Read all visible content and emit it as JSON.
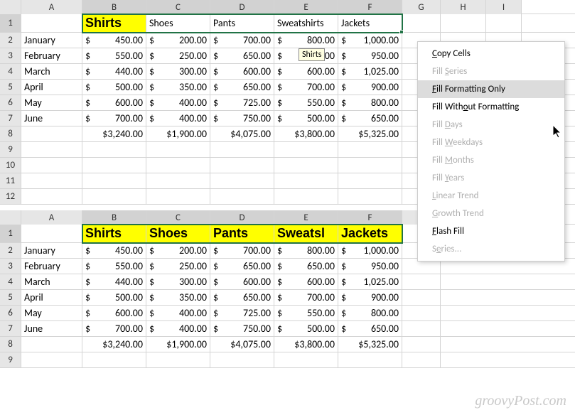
{
  "columns": [
    "A",
    "B",
    "C",
    "D",
    "E",
    "F",
    "G",
    "H",
    "I"
  ],
  "top": {
    "rows": [
      "1",
      "2",
      "3",
      "4",
      "5",
      "6",
      "7",
      "8",
      "9",
      "10",
      "11",
      "12"
    ],
    "headers": [
      "Shirts",
      "Shoes",
      "Pants",
      "Sweatshirts",
      "Jackets"
    ],
    "months": [
      "January",
      "February",
      "March",
      "April",
      "May",
      "June"
    ],
    "data": [
      [
        "$ 450.00",
        "$ 200.00",
        "$ 700.00",
        "$ 800.00",
        "$1,000.00"
      ],
      [
        "$ 550.00",
        "$ 250.00",
        "$ 650.00",
        "$ 650.00",
        "$ 950.00"
      ],
      [
        "$ 440.00",
        "$ 300.00",
        "$ 600.00",
        "$ 600.00",
        "$1,025.00"
      ],
      [
        "$ 500.00",
        "$ 350.00",
        "$ 650.00",
        "$ 700.00",
        "$ 900.00"
      ],
      [
        "$ 600.00",
        "$ 400.00",
        "$ 725.00",
        "$ 550.00",
        "$ 800.00"
      ],
      [
        "$ 700.00",
        "$ 400.00",
        "$ 750.00",
        "$ 500.00",
        "$ 650.00"
      ]
    ],
    "totals": [
      "$3,240.00",
      "$1,900.00",
      "$4,075.00",
      "$3,800.00",
      "$5,325.00"
    ],
    "tooltip": "Shirts"
  },
  "bottom": {
    "rows": [
      "1",
      "2",
      "3",
      "4",
      "5",
      "6",
      "7",
      "8",
      "9"
    ],
    "headers": [
      "Shirts",
      "Shoes",
      "Pants",
      "Sweatsl",
      "Jackets"
    ],
    "months": [
      "January",
      "February",
      "March",
      "April",
      "May",
      "June"
    ],
    "data": [
      [
        "$ 450.00",
        "$ 200.00",
        "$ 700.00",
        "$ 800.00",
        "$1,000.00"
      ],
      [
        "$ 550.00",
        "$ 250.00",
        "$ 650.00",
        "$ 650.00",
        "$ 950.00"
      ],
      [
        "$ 440.00",
        "$ 300.00",
        "$ 600.00",
        "$ 600.00",
        "$1,025.00"
      ],
      [
        "$ 500.00",
        "$ 350.00",
        "$ 650.00",
        "$ 700.00",
        "$ 900.00"
      ],
      [
        "$ 600.00",
        "$ 400.00",
        "$ 725.00",
        "$ 550.00",
        "$ 800.00"
      ],
      [
        "$ 700.00",
        "$ 400.00",
        "$ 750.00",
        "$ 500.00",
        "$ 650.00"
      ]
    ],
    "totals": [
      "$3,240.00",
      "$1,900.00",
      "$4,075.00",
      "$3,800.00",
      "$5,325.00"
    ]
  },
  "menu": {
    "items": [
      {
        "label": "Copy Cells",
        "accel": "C",
        "enabled": true
      },
      {
        "label": "Fill Series",
        "accel": "S",
        "enabled": false
      },
      {
        "label": "Fill Formatting Only",
        "accel": "F",
        "enabled": true,
        "hover": true
      },
      {
        "label": "Fill Without Formatting",
        "accel": "O",
        "enabled": true
      },
      {
        "label": "Fill Days",
        "accel": "D",
        "enabled": false
      },
      {
        "label": "Fill Weekdays",
        "accel": "W",
        "enabled": false
      },
      {
        "label": "Fill Months",
        "accel": "M",
        "enabled": false
      },
      {
        "label": "Fill Years",
        "accel": "Y",
        "enabled": false
      },
      {
        "label": "Linear Trend",
        "accel": "L",
        "enabled": false
      },
      {
        "label": "Growth Trend",
        "accel": "G",
        "enabled": false
      },
      {
        "label": "Flash Fill",
        "accel": "F",
        "enabled": true
      },
      {
        "label": "Series...",
        "accel": "e",
        "enabled": false
      }
    ]
  },
  "watermark": "groovyPost.com"
}
